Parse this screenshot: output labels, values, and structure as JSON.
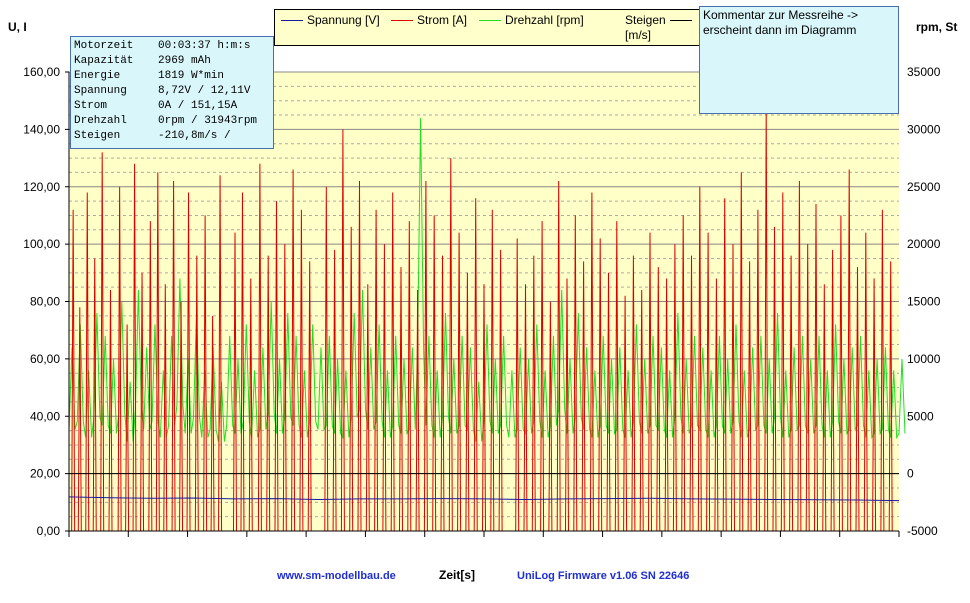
{
  "chart_data": {
    "type": "line",
    "ylabel_left": "U, I",
    "ylabel_right": "rpm, St",
    "xlabel": "Zeit[s]",
    "ylim_left": [
      0,
      160
    ],
    "ylim_right": [
      -5000,
      35000
    ],
    "yticks_left": [
      "0,00",
      "20,00",
      "40,00",
      "60,00",
      "80,00",
      "100,00",
      "120,00",
      "140,00",
      "160,00"
    ],
    "yticks_right": [
      "-5000",
      "0",
      "5000",
      "10000",
      "15000",
      "20000",
      "25000",
      "30000",
      "35000"
    ],
    "x_tick_count": 14,
    "plot_background": "#ffffc8",
    "grid": true,
    "legend_position": "top",
    "series": [
      {
        "name": "Spannung [V]",
        "axis": "left",
        "color": "#1a1aa0",
        "x": [
          0,
          5,
          10,
          15,
          20,
          25,
          30,
          35,
          40,
          45,
          50,
          55,
          60,
          65,
          70,
          75,
          80,
          85,
          90,
          95,
          100
        ],
        "values": [
          11.9,
          11.6,
          11.4,
          11.5,
          11.2,
          11.3,
          11.0,
          11.2,
          11.2,
          11.3,
          11.2,
          11.0,
          11.2,
          11.3,
          11.4,
          11.2,
          11.1,
          11.0,
          10.9,
          10.8,
          10.6
        ]
      },
      {
        "name": "Strom [A]",
        "axis": "left",
        "color": "#dd0000",
        "x": [
          0.5,
          1.3,
          2.2,
          3.1,
          4.0,
          5.0,
          6.1,
          7.0,
          7.9,
          8.8,
          9.8,
          10.7,
          11.6,
          12.6,
          13.5,
          14.4,
          15.4,
          16.4,
          17.3,
          18.2,
          20.0,
          20.9,
          21.9,
          23.0,
          24.0,
          25.0,
          26.0,
          27.0,
          28.0,
          29.0,
          31.0,
          32.0,
          33.0,
          34.0,
          35.0,
          36.0,
          37.0,
          38.0,
          39.0,
          40.0,
          41.0,
          42.0,
          43.0,
          44.0,
          45.0,
          46.0,
          47.0,
          48.0,
          49.0,
          50.0,
          51.0,
          52.0,
          54.0,
          55.0,
          56.0,
          57.0,
          58.0,
          59.0,
          60.0,
          61.0,
          62.0,
          63.0,
          64.0,
          65.0,
          66.0,
          67.0,
          68.0,
          69.0,
          70.0,
          71.0,
          72.0,
          73.0,
          74.0,
          75.0,
          76.0,
          77.0,
          78.0,
          79.0,
          80.0,
          81.0,
          82.0,
          83.0,
          84.0,
          85.0,
          86.0,
          87.0,
          88.0,
          89.0,
          90.0,
          91.0,
          92.0,
          93.0,
          94.0,
          95.0,
          96.0,
          97.0,
          98.0,
          99.0
        ],
        "values": [
          112,
          78,
          118,
          95,
          132,
          84,
          120,
          72,
          128,
          90,
          108,
          125,
          86,
          122,
          80,
          118,
          96,
          110,
          75,
          124,
          104,
          118,
          88,
          128,
          96,
          115,
          100,
          126,
          112,
          94,
          120,
          98,
          140,
          106,
          122,
          86,
          112,
          100,
          118,
          92,
          108,
          84,
          122,
          110,
          96,
          130,
          104,
          90,
          116,
          86,
          112,
          98,
          102,
          86,
          96,
          108,
          80,
          122,
          88,
          110,
          94,
          118,
          102,
          90,
          108,
          82,
          96,
          84,
          104,
          92,
          88,
          100,
          110,
          96,
          120,
          104,
          88,
          116,
          100,
          125,
          94,
          112,
          148,
          106,
          118,
          96,
          122,
          100,
          114,
          86,
          98,
          110,
          126,
          92,
          104,
          88,
          112,
          94
        ]
      },
      {
        "name": "Drehzahl [rpm]",
        "axis": "right",
        "color": "#22dd22",
        "x": [
          0,
          1,
          2,
          3,
          4,
          5,
          6,
          7,
          8,
          9,
          10,
          11,
          12,
          13,
          14,
          15,
          16,
          17,
          18,
          19,
          20,
          21,
          22,
          23,
          24,
          25,
          26,
          27,
          28,
          29,
          30,
          31,
          32,
          33,
          34,
          35,
          36,
          37,
          38,
          39,
          40,
          41,
          42,
          43,
          44,
          45,
          46,
          47,
          48,
          49,
          50,
          51,
          52,
          53,
          54,
          55,
          56,
          57,
          58,
          59,
          60,
          61,
          62,
          63,
          64,
          65,
          66,
          67,
          68,
          69,
          70,
          71,
          72,
          73,
          74,
          75,
          76,
          77,
          78,
          79,
          80,
          81,
          82,
          83,
          84,
          85,
          86,
          87,
          88,
          89,
          90,
          91,
          92,
          93,
          94,
          95,
          96,
          97,
          98,
          99,
          100
        ],
        "values": [
          11000,
          13000,
          9000,
          14000,
          12000,
          10000,
          15000,
          8000,
          16000,
          11000,
          13000,
          9000,
          12000,
          17000,
          10000,
          14000,
          9000,
          11000,
          8000,
          12000,
          10000,
          13000,
          9000,
          11000,
          15000,
          10000,
          14000,
          12000,
          9000,
          13000,
          11000,
          12000,
          10000,
          9000,
          14000,
          16000,
          11000,
          13000,
          9000,
          12000,
          10000,
          11000,
          31000,
          12000,
          9000,
          14000,
          10000,
          12000,
          11000,
          8000,
          13000,
          10000,
          12000,
          9000,
          11000,
          10000,
          13000,
          9000,
          12000,
          16000,
          10000,
          14000,
          11000,
          9000,
          12000,
          10000,
          11000,
          9000,
          13000,
          10000,
          12000,
          11000,
          9000,
          14000,
          10000,
          12000,
          11000,
          9000,
          12000,
          10000,
          13000,
          9000,
          11000,
          12000,
          10000,
          14000,
          9000,
          11000,
          12000,
          10000,
          12000,
          9000,
          13000,
          10000,
          11000,
          12000,
          9000,
          10000,
          11000,
          9000,
          10000
        ]
      },
      {
        "name": "Steigen [m/s]",
        "axis": "right",
        "color": "#000000",
        "x": [
          0,
          100
        ],
        "values": [
          0,
          0
        ]
      }
    ]
  },
  "info": {
    "rows": [
      {
        "key": "Motorzeit",
        "value": "00:03:37 h:m:s"
      },
      {
        "key": "Kapazität",
        "value": "2969 mAh"
      },
      {
        "key": "Energie",
        "value": "1819 W*min"
      },
      {
        "key": "Spannung",
        "value": "8,72V / 12,11V"
      },
      {
        "key": "Strom",
        "value": "0A / 151,15A"
      },
      {
        "key": "Drehzahl",
        "value": "0rpm / 31943rpm"
      },
      {
        "key": "Steigen",
        "value": "-210,8m/s /"
      }
    ]
  },
  "legend": {
    "items": [
      {
        "label": "Spannung [V]",
        "color": "#1a1aa0"
      },
      {
        "label": "Strom [A]",
        "color": "#dd0000"
      },
      {
        "label": "Drehzahl [rpm]",
        "color": "#22dd22"
      },
      {
        "label": "Steigen\n[m/s]",
        "color": "#000000"
      }
    ]
  },
  "comment": {
    "text": "Kommentar zur Messreihe -> erscheint dann im Diagramm"
  },
  "footer": {
    "website": "www.sm-modellbau.de",
    "firmware": "UniLog Firmware v1.06 SN 22646"
  }
}
